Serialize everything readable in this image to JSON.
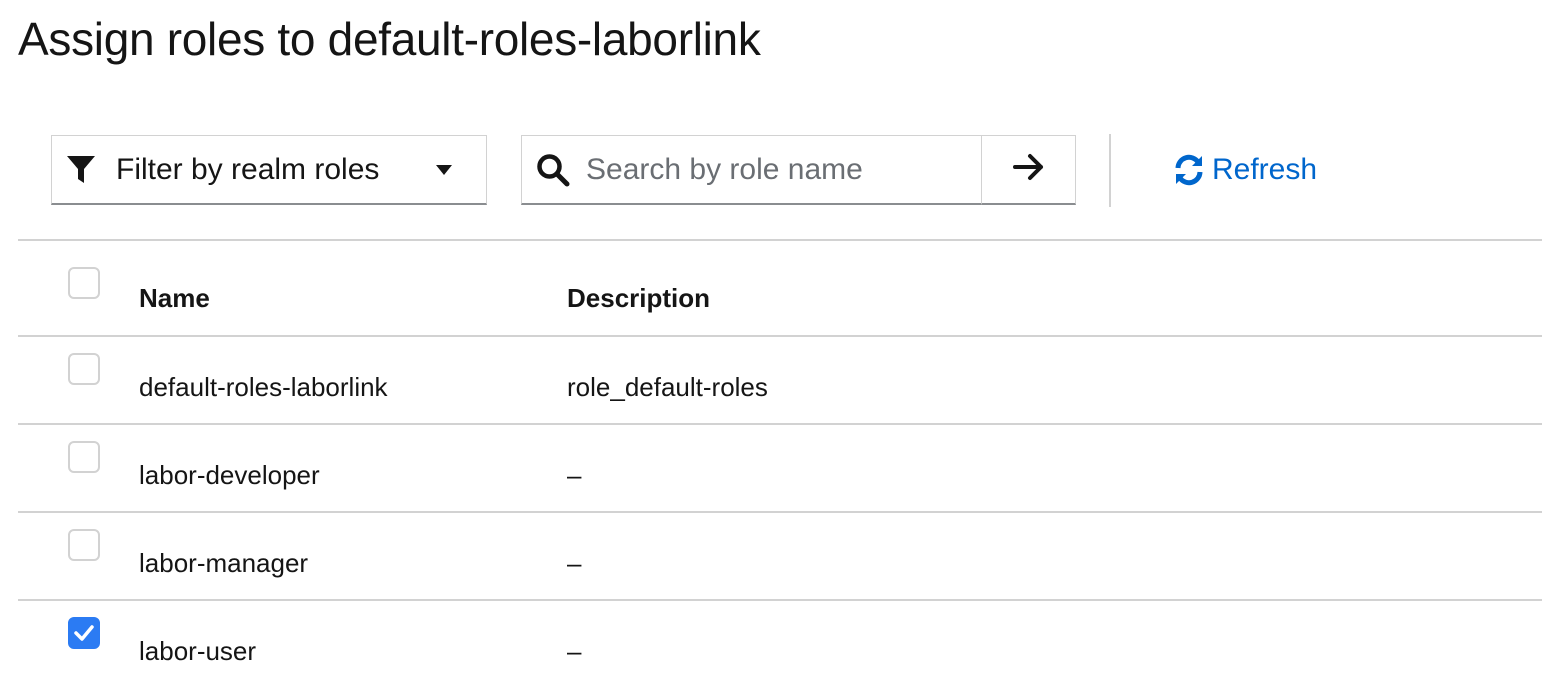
{
  "page": {
    "title": "Assign roles to default-roles-laborlink"
  },
  "toolbar": {
    "filter_label": "Filter by realm roles",
    "search_placeholder": "Search by role name",
    "search_value": "",
    "refresh_label": "Refresh"
  },
  "table": {
    "columns": [
      "Name",
      "Description"
    ],
    "rows": [
      {
        "name": "default-roles-laborlink",
        "description": "role_default-roles",
        "checked": false
      },
      {
        "name": "labor-developer",
        "description": "–",
        "checked": false
      },
      {
        "name": "labor-manager",
        "description": "–",
        "checked": false
      },
      {
        "name": "labor-user",
        "description": "–",
        "checked": true
      }
    ]
  },
  "colors": {
    "link": "#0066cc",
    "checkbox_checked": "#2b7bf3",
    "border": "#d2d2d2"
  }
}
